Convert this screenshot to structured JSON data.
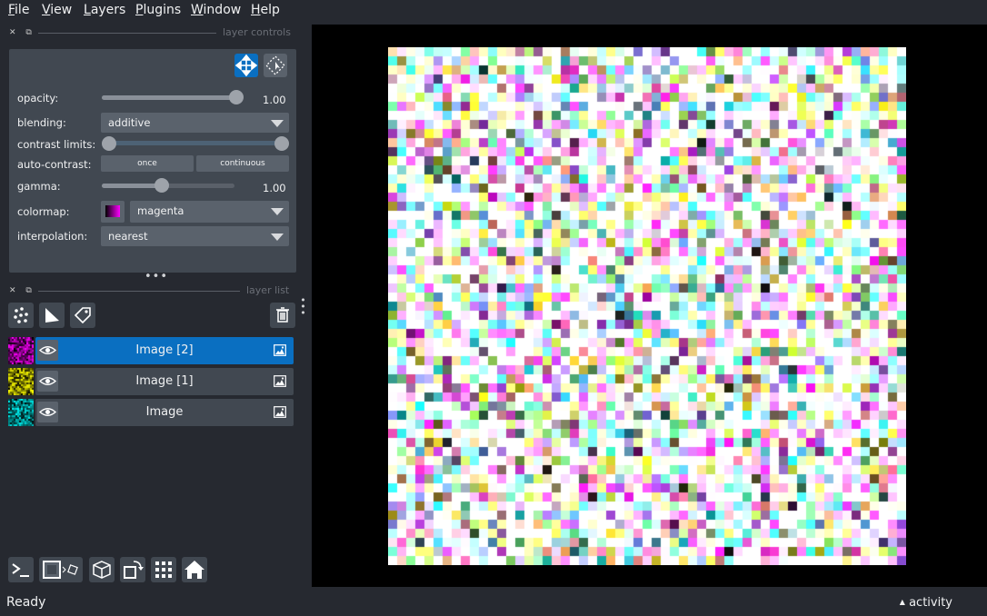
{
  "menu": {
    "items": [
      {
        "underline": "F",
        "rest": "ile"
      },
      {
        "underline": "V",
        "rest": "iew"
      },
      {
        "underline": "L",
        "rest": "ayers"
      },
      {
        "underline": "P",
        "rest": "lugins"
      },
      {
        "underline": "W",
        "rest": "indow"
      },
      {
        "underline": "H",
        "rest": "elp"
      }
    ]
  },
  "layer_controls": {
    "title": "layer controls",
    "opacity": {
      "label": "opacity:",
      "value": "1.00",
      "level": 1.0
    },
    "blending": {
      "label": "blending:",
      "value": "additive"
    },
    "contrast_limits": {
      "label": "contrast limits:",
      "low": 0.0,
      "high": 1.0
    },
    "auto_contrast": {
      "label": "auto-contrast:",
      "once": "once",
      "continuous": "continuous"
    },
    "gamma": {
      "label": "gamma:",
      "value": "1.00",
      "level": 0.45
    },
    "colormap": {
      "label": "colormap:",
      "value": "magenta"
    },
    "interpolation": {
      "label": "interpolation:",
      "value": "nearest"
    }
  },
  "layer_list": {
    "title": "layer list",
    "layers": [
      {
        "name": "Image [2]",
        "selected": true,
        "color": "#ff00ff"
      },
      {
        "name": "Image [1]",
        "selected": false,
        "color": "#ffff00"
      },
      {
        "name": "Image",
        "selected": false,
        "color": "#00ffff"
      }
    ]
  },
  "colors": {
    "accent": "#0a6fc1",
    "background": "#262930",
    "panel": "#414851",
    "canvas": "#000000"
  },
  "status": {
    "text": "Ready",
    "activity": "activity"
  }
}
